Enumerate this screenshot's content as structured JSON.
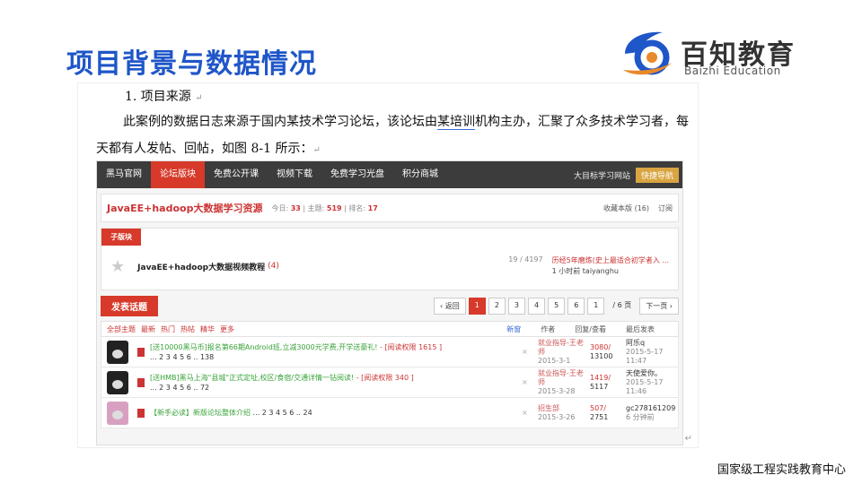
{
  "slide": {
    "title": "项目背景与数据情况",
    "footer": "国家级工程实践教育中心"
  },
  "logo": {
    "name_cn": "百知教育",
    "name_en": "Baizhi Education",
    "colors": {
      "blue": "#1f56c8",
      "orange": "#e8892b"
    }
  },
  "doc": {
    "heading": "1. 项目来源",
    "para_before": "此案例的数据日志来源于国内某技术学习论坛，该论坛由",
    "para_underlined": "某培训",
    "para_after": "机构主办，汇聚了众多技术学习者，每天都有人发帖、回帖，如图 8-1 所示：",
    "return_mark": "↵"
  },
  "forum": {
    "nav": {
      "items": [
        "黑马官网",
        "论坛版块",
        "免费公开课",
        "视频下载",
        "免费学习光盘",
        "积分商城"
      ],
      "active_index": 1,
      "right_text": "大目标学习网站",
      "quick_nav": "快捷导航"
    },
    "board": {
      "title": "JavaEE+hadoop大数据学习资源",
      "today_label": "今日:",
      "today_value": "33",
      "topics_label": "| 主题:",
      "topics_value": "519",
      "rank_label": "| 排名:",
      "rank_value": "17",
      "favorite": "收藏本版 (16)",
      "subscribe": "订阅"
    },
    "subboard": {
      "tab": "子版块",
      "name": "JavaEE+hadoop大数据视频教程",
      "count": "(4)",
      "stats": "19 / 4197",
      "last_post": "历经5年磨炼(史上最适合初学者入 ...",
      "last_time": "1 小时前 taiyanghu"
    },
    "post_button": "发表话题",
    "pager": {
      "back": "‹ 返回",
      "pages": [
        "1",
        "2",
        "3",
        "4",
        "5",
        "6"
      ],
      "current": "1",
      "input": "1",
      "total": "/ 6 页",
      "next": "下一页 ›"
    },
    "list_head": {
      "filters": [
        "全部主题",
        "最新",
        "热门",
        "热帖",
        "精华",
        "更多"
      ],
      "cols": [
        "新窗",
        "作者",
        "回复/查看",
        "最后发表"
      ]
    },
    "threads": [
      {
        "prefix": "[送10000黑马币]报名第66期Android班,立减3000元学费,开学送豪礼!",
        "hl": " - [阅读权限 1615 ]",
        "pages": "... 2 3 4 5 6 .. 138",
        "author": "就业指导-王老师",
        "date": "2015-3-1",
        "replies": "3080/",
        "views": "13100",
        "last_user": "阿乐q",
        "last_date": "2015-5-17 11:47"
      },
      {
        "prefix": "[送HMB]黑马上海\"县城\"正式定址,校区/食宿/交通详情一钻阅读!",
        "hl": " - [阅读权限 340 ]",
        "pages": "... 2 3 4 5 6 .. 72",
        "author": "就业指导-王老师",
        "date": "2015-3-28",
        "replies": "1419/",
        "views": "5117",
        "last_user": "天使爱你。",
        "last_date": "2015-5-17 11:46"
      },
      {
        "prefix": "【新手必读】新版论坛整体介绍",
        "hl": "",
        "pages": "... 2 3 4 5 6 .. 24",
        "author": "招生部",
        "date": "2015-3-26",
        "replies": "507/",
        "views": "2751",
        "last_user": "gc278161209",
        "last_date": "6 分钟前"
      }
    ]
  }
}
